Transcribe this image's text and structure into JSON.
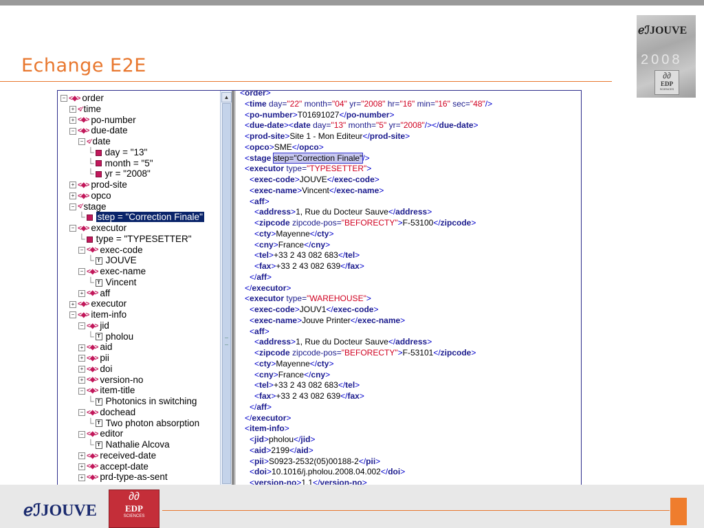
{
  "slide": {
    "title": "Echange E2E",
    "accent": "#e8772e"
  },
  "tree": [
    {
      "depth": 0,
      "toggle": "−",
      "icon": "elem",
      "text": "order"
    },
    {
      "depth": 1,
      "toggle": "+",
      "icon": "elem-open",
      "text": "time"
    },
    {
      "depth": 1,
      "toggle": "+",
      "icon": "elem",
      "text": "po-number"
    },
    {
      "depth": 1,
      "toggle": "−",
      "icon": "elem",
      "text": "due-date"
    },
    {
      "depth": 2,
      "toggle": "−",
      "icon": "elem-open",
      "text": "date"
    },
    {
      "depth": 3,
      "toggle": "",
      "icon": "attr",
      "text": "day = \"13\""
    },
    {
      "depth": 3,
      "toggle": "",
      "icon": "attr",
      "text": "month = \"5\""
    },
    {
      "depth": 3,
      "toggle": "",
      "icon": "attr",
      "text": "yr = \"2008\""
    },
    {
      "depth": 1,
      "toggle": "+",
      "icon": "elem",
      "text": "prod-site"
    },
    {
      "depth": 1,
      "toggle": "+",
      "icon": "elem",
      "text": "opco"
    },
    {
      "depth": 1,
      "toggle": "−",
      "icon": "elem-open",
      "text": "stage"
    },
    {
      "depth": 2,
      "toggle": "",
      "icon": "attr",
      "text": "step = \"Correction Finale\"",
      "selected": true
    },
    {
      "depth": 1,
      "toggle": "−",
      "icon": "elem",
      "text": "executor"
    },
    {
      "depth": 2,
      "toggle": "",
      "icon": "attr",
      "text": "type = \"TYPESETTER\""
    },
    {
      "depth": 2,
      "toggle": "−",
      "icon": "elem",
      "text": "exec-code"
    },
    {
      "depth": 3,
      "toggle": "",
      "icon": "text",
      "text": "JOUVE"
    },
    {
      "depth": 2,
      "toggle": "−",
      "icon": "elem",
      "text": "exec-name"
    },
    {
      "depth": 3,
      "toggle": "",
      "icon": "text",
      "text": "Vincent"
    },
    {
      "depth": 2,
      "toggle": "+",
      "icon": "elem",
      "text": "aff"
    },
    {
      "depth": 1,
      "toggle": "+",
      "icon": "elem",
      "text": "executor"
    },
    {
      "depth": 1,
      "toggle": "−",
      "icon": "elem",
      "text": "item-info"
    },
    {
      "depth": 2,
      "toggle": "−",
      "icon": "elem",
      "text": "jid"
    },
    {
      "depth": 3,
      "toggle": "",
      "icon": "text",
      "text": "pholou"
    },
    {
      "depth": 2,
      "toggle": "+",
      "icon": "elem",
      "text": "aid"
    },
    {
      "depth": 2,
      "toggle": "+",
      "icon": "elem",
      "text": "pii"
    },
    {
      "depth": 2,
      "toggle": "+",
      "icon": "elem",
      "text": "doi"
    },
    {
      "depth": 2,
      "toggle": "+",
      "icon": "elem",
      "text": "version-no"
    },
    {
      "depth": 2,
      "toggle": "−",
      "icon": "elem",
      "text": "item-title"
    },
    {
      "depth": 3,
      "toggle": "",
      "icon": "text",
      "text": "Photonics in switching"
    },
    {
      "depth": 2,
      "toggle": "−",
      "icon": "elem",
      "text": "dochead"
    },
    {
      "depth": 3,
      "toggle": "",
      "icon": "text",
      "text": "Two photon absorption"
    },
    {
      "depth": 2,
      "toggle": "−",
      "icon": "elem",
      "text": "editor"
    },
    {
      "depth": 3,
      "toggle": "",
      "icon": "text",
      "text": "Nathalie Alcova"
    },
    {
      "depth": 2,
      "toggle": "+",
      "icon": "elem",
      "text": "received-date"
    },
    {
      "depth": 2,
      "toggle": "+",
      "icon": "elem",
      "text": "accept-date"
    },
    {
      "depth": 2,
      "toggle": "+",
      "icon": "elem",
      "text": "prd-type-as-sent"
    }
  ],
  "code": [
    {
      "indent": 0,
      "parts": [
        [
          "br",
          "<"
        ],
        [
          "tn",
          "order"
        ],
        [
          "br",
          ">"
        ]
      ]
    },
    {
      "indent": 1,
      "parts": [
        [
          "br",
          "<"
        ],
        [
          "tn",
          "time"
        ],
        [
          "an",
          " day="
        ],
        [
          "av",
          "\"22\""
        ],
        [
          "an",
          " month="
        ],
        [
          "av",
          "\"04\""
        ],
        [
          "an",
          " yr="
        ],
        [
          "av",
          "\"2008\""
        ],
        [
          "an",
          " hr="
        ],
        [
          "av",
          "\"16\""
        ],
        [
          "an",
          " min="
        ],
        [
          "av",
          "\"16\""
        ],
        [
          "an",
          " sec="
        ],
        [
          "av",
          "\"48\""
        ],
        [
          "br",
          "/>"
        ]
      ]
    },
    {
      "indent": 1,
      "parts": [
        [
          "br",
          "<"
        ],
        [
          "tn",
          "po-number"
        ],
        [
          "br",
          ">"
        ],
        [
          "t",
          "T01691027"
        ],
        [
          "br",
          "</"
        ],
        [
          "tn",
          "po-number"
        ],
        [
          "br",
          ">"
        ]
      ]
    },
    {
      "indent": 1,
      "parts": [
        [
          "br",
          "<"
        ],
        [
          "tn",
          "due-date"
        ],
        [
          "br",
          ">"
        ],
        [
          "br",
          "<"
        ],
        [
          "tn",
          "date"
        ],
        [
          "an",
          " day="
        ],
        [
          "av",
          "\"13\""
        ],
        [
          "an",
          " month="
        ],
        [
          "av",
          "\"5\""
        ],
        [
          "an",
          " yr="
        ],
        [
          "av",
          "\"2008\""
        ],
        [
          "br",
          "/>"
        ],
        [
          "br",
          "</"
        ],
        [
          "tn",
          "due-date"
        ],
        [
          "br",
          ">"
        ]
      ]
    },
    {
      "indent": 1,
      "parts": [
        [
          "br",
          "<"
        ],
        [
          "tn",
          "prod-site"
        ],
        [
          "br",
          ">"
        ],
        [
          "t",
          "Site 1 - Mon Editeur"
        ],
        [
          "br",
          "</"
        ],
        [
          "tn",
          "prod-site"
        ],
        [
          "br",
          ">"
        ]
      ]
    },
    {
      "indent": 1,
      "parts": [
        [
          "br",
          "<"
        ],
        [
          "tn",
          "opco"
        ],
        [
          "br",
          ">"
        ],
        [
          "t",
          "SME"
        ],
        [
          "br",
          "</"
        ],
        [
          "tn",
          "opco"
        ],
        [
          "br",
          ">"
        ]
      ]
    },
    {
      "indent": 1,
      "parts": [
        [
          "br",
          "<"
        ],
        [
          "tn",
          "stage"
        ],
        [
          "t",
          " "
        ],
        [
          "hl",
          "step=\"Correction Finale\""
        ],
        [
          "br",
          "/>"
        ]
      ]
    },
    {
      "indent": 1,
      "parts": [
        [
          "br",
          "<"
        ],
        [
          "tn",
          "executor"
        ],
        [
          "an",
          " type="
        ],
        [
          "av",
          "\"TYPESETTER\""
        ],
        [
          "br",
          ">"
        ]
      ]
    },
    {
      "indent": 2,
      "parts": [
        [
          "br",
          "<"
        ],
        [
          "tn",
          "exec-code"
        ],
        [
          "br",
          ">"
        ],
        [
          "t",
          "JOUVE"
        ],
        [
          "br",
          "</"
        ],
        [
          "tn",
          "exec-code"
        ],
        [
          "br",
          ">"
        ]
      ]
    },
    {
      "indent": 2,
      "parts": [
        [
          "br",
          "<"
        ],
        [
          "tn",
          "exec-name"
        ],
        [
          "br",
          ">"
        ],
        [
          "t",
          "Vincent"
        ],
        [
          "br",
          "</"
        ],
        [
          "tn",
          "exec-name"
        ],
        [
          "br",
          ">"
        ]
      ]
    },
    {
      "indent": 2,
      "parts": [
        [
          "br",
          "<"
        ],
        [
          "tn",
          "aff"
        ],
        [
          "br",
          ">"
        ]
      ]
    },
    {
      "indent": 3,
      "parts": [
        [
          "br",
          "<"
        ],
        [
          "tn",
          "address"
        ],
        [
          "br",
          ">"
        ],
        [
          "t",
          "1, Rue du Docteur Sauve"
        ],
        [
          "br",
          "</"
        ],
        [
          "tn",
          "address"
        ],
        [
          "br",
          ">"
        ]
      ]
    },
    {
      "indent": 3,
      "parts": [
        [
          "br",
          "<"
        ],
        [
          "tn",
          "zipcode"
        ],
        [
          "an",
          " zipcode-pos="
        ],
        [
          "av",
          "\"BEFORECTY\""
        ],
        [
          "br",
          ">"
        ],
        [
          "t",
          "F-53100"
        ],
        [
          "br",
          "</"
        ],
        [
          "tn",
          "zipcode"
        ],
        [
          "br",
          ">"
        ]
      ]
    },
    {
      "indent": 3,
      "parts": [
        [
          "br",
          "<"
        ],
        [
          "tn",
          "cty"
        ],
        [
          "br",
          ">"
        ],
        [
          "t",
          "Mayenne"
        ],
        [
          "br",
          "</"
        ],
        [
          "tn",
          "cty"
        ],
        [
          "br",
          ">"
        ]
      ]
    },
    {
      "indent": 3,
      "parts": [
        [
          "br",
          "<"
        ],
        [
          "tn",
          "cny"
        ],
        [
          "br",
          ">"
        ],
        [
          "t",
          "France"
        ],
        [
          "br",
          "</"
        ],
        [
          "tn",
          "cny"
        ],
        [
          "br",
          ">"
        ]
      ]
    },
    {
      "indent": 3,
      "parts": [
        [
          "br",
          "<"
        ],
        [
          "tn",
          "tel"
        ],
        [
          "br",
          ">"
        ],
        [
          "t",
          "+33 2 43 082 683"
        ],
        [
          "br",
          "</"
        ],
        [
          "tn",
          "tel"
        ],
        [
          "br",
          ">"
        ]
      ]
    },
    {
      "indent": 3,
      "parts": [
        [
          "br",
          "<"
        ],
        [
          "tn",
          "fax"
        ],
        [
          "br",
          ">"
        ],
        [
          "t",
          "+33 2 43 082 639"
        ],
        [
          "br",
          "</"
        ],
        [
          "tn",
          "fax"
        ],
        [
          "br",
          ">"
        ]
      ]
    },
    {
      "indent": 2,
      "parts": [
        [
          "br",
          "</"
        ],
        [
          "tn",
          "aff"
        ],
        [
          "br",
          ">"
        ]
      ]
    },
    {
      "indent": 1,
      "parts": [
        [
          "br",
          "</"
        ],
        [
          "tn",
          "executor"
        ],
        [
          "br",
          ">"
        ]
      ]
    },
    {
      "indent": 1,
      "parts": [
        [
          "br",
          "<"
        ],
        [
          "tn",
          "executor"
        ],
        [
          "an",
          " type="
        ],
        [
          "av",
          "\"WAREHOUSE\""
        ],
        [
          "br",
          ">"
        ]
      ]
    },
    {
      "indent": 2,
      "parts": [
        [
          "br",
          "<"
        ],
        [
          "tn",
          "exec-code"
        ],
        [
          "br",
          ">"
        ],
        [
          "t",
          "JOUV1"
        ],
        [
          "br",
          "</"
        ],
        [
          "tn",
          "exec-code"
        ],
        [
          "br",
          ">"
        ]
      ]
    },
    {
      "indent": 2,
      "parts": [
        [
          "br",
          "<"
        ],
        [
          "tn",
          "exec-name"
        ],
        [
          "br",
          ">"
        ],
        [
          "t",
          "Jouve Printer"
        ],
        [
          "br",
          "</"
        ],
        [
          "tn",
          "exec-name"
        ],
        [
          "br",
          ">"
        ]
      ]
    },
    {
      "indent": 2,
      "parts": [
        [
          "br",
          "<"
        ],
        [
          "tn",
          "aff"
        ],
        [
          "br",
          ">"
        ]
      ]
    },
    {
      "indent": 3,
      "parts": [
        [
          "br",
          "<"
        ],
        [
          "tn",
          "address"
        ],
        [
          "br",
          ">"
        ],
        [
          "t",
          "1, Rue du Docteur Sauve"
        ],
        [
          "br",
          "</"
        ],
        [
          "tn",
          "address"
        ],
        [
          "br",
          ">"
        ]
      ]
    },
    {
      "indent": 3,
      "parts": [
        [
          "br",
          "<"
        ],
        [
          "tn",
          "zipcode"
        ],
        [
          "an",
          " zipcode-pos="
        ],
        [
          "av",
          "\"BEFORECTY\""
        ],
        [
          "br",
          ">"
        ],
        [
          "t",
          "F-53101"
        ],
        [
          "br",
          "</"
        ],
        [
          "tn",
          "zipcode"
        ],
        [
          "br",
          ">"
        ]
      ]
    },
    {
      "indent": 3,
      "parts": [
        [
          "br",
          "<"
        ],
        [
          "tn",
          "cty"
        ],
        [
          "br",
          ">"
        ],
        [
          "t",
          "Mayenne"
        ],
        [
          "br",
          "</"
        ],
        [
          "tn",
          "cty"
        ],
        [
          "br",
          ">"
        ]
      ]
    },
    {
      "indent": 3,
      "parts": [
        [
          "br",
          "<"
        ],
        [
          "tn",
          "cny"
        ],
        [
          "br",
          ">"
        ],
        [
          "t",
          "France"
        ],
        [
          "br",
          "</"
        ],
        [
          "tn",
          "cny"
        ],
        [
          "br",
          ">"
        ]
      ]
    },
    {
      "indent": 3,
      "parts": [
        [
          "br",
          "<"
        ],
        [
          "tn",
          "tel"
        ],
        [
          "br",
          ">"
        ],
        [
          "t",
          "+33 2 43 082 683"
        ],
        [
          "br",
          "</"
        ],
        [
          "tn",
          "tel"
        ],
        [
          "br",
          ">"
        ]
      ]
    },
    {
      "indent": 3,
      "parts": [
        [
          "br",
          "<"
        ],
        [
          "tn",
          "fax"
        ],
        [
          "br",
          ">"
        ],
        [
          "t",
          "+33 2 43 082 639"
        ],
        [
          "br",
          "</"
        ],
        [
          "tn",
          "fax"
        ],
        [
          "br",
          ">"
        ]
      ]
    },
    {
      "indent": 2,
      "parts": [
        [
          "br",
          "</"
        ],
        [
          "tn",
          "aff"
        ],
        [
          "br",
          ">"
        ]
      ]
    },
    {
      "indent": 1,
      "parts": [
        [
          "br",
          "</"
        ],
        [
          "tn",
          "executor"
        ],
        [
          "br",
          ">"
        ]
      ]
    },
    {
      "indent": 1,
      "parts": [
        [
          "br",
          "<"
        ],
        [
          "tn",
          "item-info"
        ],
        [
          "br",
          ">"
        ]
      ]
    },
    {
      "indent": 2,
      "parts": [
        [
          "br",
          "<"
        ],
        [
          "tn",
          "jid"
        ],
        [
          "br",
          ">"
        ],
        [
          "t",
          "pholou"
        ],
        [
          "br",
          "</"
        ],
        [
          "tn",
          "jid"
        ],
        [
          "br",
          ">"
        ]
      ]
    },
    {
      "indent": 2,
      "parts": [
        [
          "br",
          "<"
        ],
        [
          "tn",
          "aid"
        ],
        [
          "br",
          ">"
        ],
        [
          "t",
          "2199"
        ],
        [
          "br",
          "</"
        ],
        [
          "tn",
          "aid"
        ],
        [
          "br",
          ">"
        ]
      ]
    },
    {
      "indent": 2,
      "parts": [
        [
          "br",
          "<"
        ],
        [
          "tn",
          "pii"
        ],
        [
          "br",
          ">"
        ],
        [
          "t",
          "S0923-2532(05)00188-2"
        ],
        [
          "br",
          "</"
        ],
        [
          "tn",
          "pii"
        ],
        [
          "br",
          ">"
        ]
      ]
    },
    {
      "indent": 2,
      "parts": [
        [
          "br",
          "<"
        ],
        [
          "tn",
          "doi"
        ],
        [
          "br",
          ">"
        ],
        [
          "t",
          "10.1016/j.pholou.2008.04.002"
        ],
        [
          "br",
          "</"
        ],
        [
          "tn",
          "doi"
        ],
        [
          "br",
          ">"
        ]
      ]
    },
    {
      "indent": 2,
      "parts": [
        [
          "br",
          "<"
        ],
        [
          "tn",
          "version-no"
        ],
        [
          "br",
          ">"
        ],
        [
          "t",
          "1.1"
        ],
        [
          "br",
          "</"
        ],
        [
          "tn",
          "version-no"
        ],
        [
          "br",
          ">"
        ]
      ]
    }
  ],
  "logos": {
    "corner_brand": "JOUVE",
    "corner_year": "2008",
    "footer_brand": "JOUVE",
    "edp_name": "EDP",
    "edp_sub": "SCIENCES",
    "jouve_prefix": "ℯℐ"
  },
  "colors": {
    "tree_selection": "#0a246a",
    "tag_name": "#1a1a8c",
    "attr_value": "#d00020",
    "footer_square": "#ef7d2d",
    "edp_red": "#c42e39"
  }
}
